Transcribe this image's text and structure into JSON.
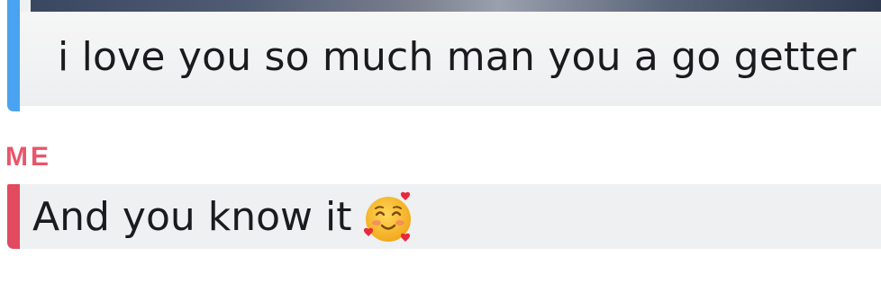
{
  "messages": [
    {
      "type": "story-reply",
      "sender": "",
      "text": "i love you so much man you a go getter",
      "accent_color": "#4aa3f0"
    },
    {
      "type": "text",
      "sender": "ME",
      "text": "And you know it",
      "emoji": "smiling-face-with-hearts",
      "accent_color": "#e24a5f",
      "sender_color": "#e8566b"
    }
  ]
}
